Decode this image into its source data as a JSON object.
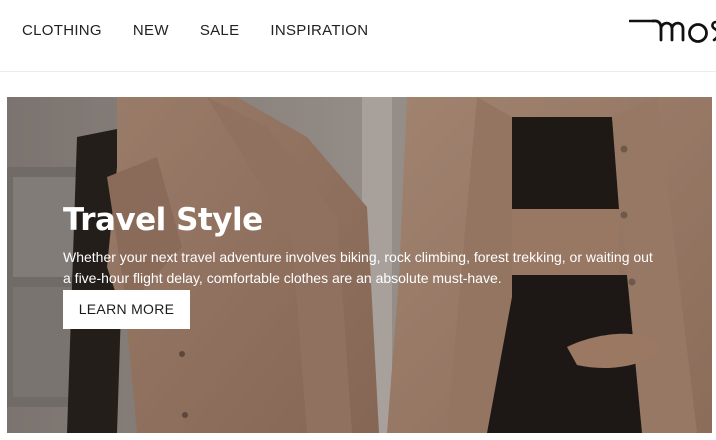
{
  "nav": {
    "items": [
      {
        "label": "CLOTHING"
      },
      {
        "label": "NEW"
      },
      {
        "label": "SALE"
      },
      {
        "label": "INSPIRATION"
      }
    ]
  },
  "brand": {
    "logo_icon": "brand-wordmark-logo",
    "logo_text": "mos"
  },
  "hero": {
    "title": "Travel Style",
    "text": "Whether your next travel adventure involves biking, rock climbing, forest trekking, or waiting out a five-hour flight delay, comfortable clothes are an absolute must-have.",
    "cta_label": "LEARN MORE"
  },
  "colors": {
    "nav_text": "#222222",
    "hero_overlay": "#6b5547",
    "garment": "#c9a48c",
    "cta_bg": "#ffffff"
  }
}
